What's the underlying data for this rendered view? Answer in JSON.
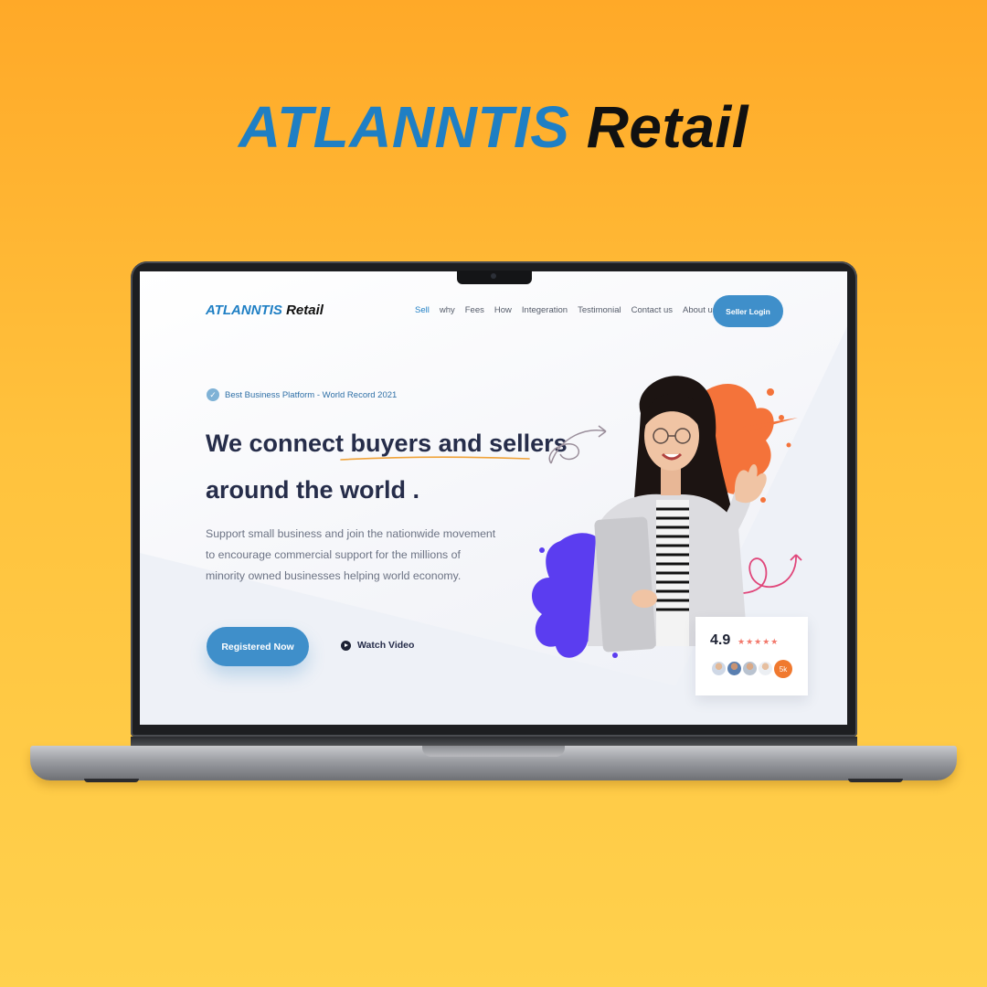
{
  "promo": {
    "title_part1": "ATLANNTIS",
    "title_part2": "Retail"
  },
  "header": {
    "logo_part1": "ATLANNTIS",
    "logo_part2": "Retail",
    "nav": [
      {
        "label": "Sell",
        "active": true
      },
      {
        "label": "why"
      },
      {
        "label": "Fees"
      },
      {
        "label": "How"
      },
      {
        "label": "Integeration"
      },
      {
        "label": "Testimonial"
      },
      {
        "label": "Contact us"
      },
      {
        "label": "About us"
      }
    ],
    "login_label": "Seller Login"
  },
  "hero": {
    "badge": "Best Business Platform - World Record 2021",
    "headline_part1": "We connect",
    "headline_highlight": "buyers and sellers",
    "headline_part2": "around the world .",
    "description": "Support small business and join the nationwide movement to encourage commercial support for the millions of minority owned businesses helping world economy.",
    "primary_button": "Registered Now",
    "secondary_button": "Watch Video"
  },
  "rating": {
    "score": "4.9",
    "stars": "★★★★★",
    "count": "5k"
  },
  "colors": {
    "accent": "#3f8fca",
    "brand_blue": "#1f7fc4",
    "heading": "#262d4a",
    "splash_orange": "#f4733a",
    "splash_purple": "#5b3df0",
    "count_badge": "#f0792f"
  },
  "icons": {
    "badge": "verified-check-icon",
    "watch": "play-icon",
    "stars": "star-icon"
  }
}
